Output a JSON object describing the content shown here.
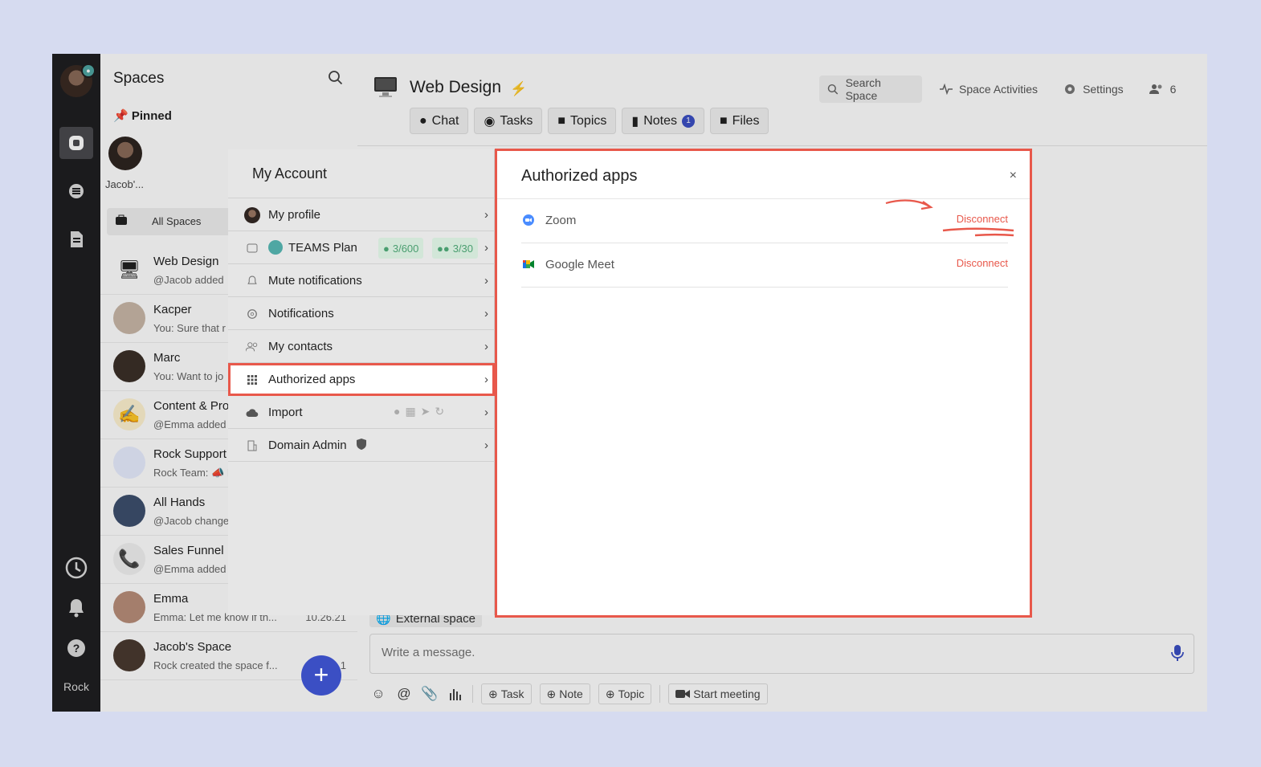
{
  "rail": {
    "label": "Rock"
  },
  "spaces": {
    "title": "Spaces",
    "pinned_label": "Pinned",
    "pinned_name": "Jacob'...",
    "all_spaces_label": "All Spaces",
    "items": [
      {
        "name": "Web Design",
        "sub": "@Jacob added",
        "time": "",
        "thumb": "🖥"
      },
      {
        "name": "Kacper",
        "sub": "You: Sure that r",
        "time": "",
        "thumb": ""
      },
      {
        "name": "Marc",
        "sub": "You: Want to jo",
        "time": "",
        "thumb": ""
      },
      {
        "name": "Content & Pro",
        "sub": "@Emma added",
        "time": "",
        "thumb": "✍"
      },
      {
        "name": "Rock Support",
        "sub": "Rock Team: 📣 I",
        "time": "",
        "thumb": ""
      },
      {
        "name": "All Hands",
        "sub": "@Jacob change",
        "time": "",
        "thumb": ""
      },
      {
        "name": "Sales Funnel",
        "sub": "@Emma added",
        "time": "",
        "thumb": "📞"
      },
      {
        "name": "Emma",
        "sub": "Emma: Let me know if th...",
        "time": "10.26.21",
        "thumb": ""
      },
      {
        "name": "Jacob's Space",
        "sub": "Rock created the space f...",
        "time": "1",
        "thumb": ""
      }
    ],
    "fab_label": "+"
  },
  "main": {
    "title": "Web Design",
    "tabs": [
      {
        "label": "Chat",
        "icon": "chat-bubble-icon"
      },
      {
        "label": "Tasks",
        "icon": "tasks-icon"
      },
      {
        "label": "Topics",
        "icon": "topics-icon"
      },
      {
        "label": "Notes",
        "icon": "notes-icon",
        "badge": "1"
      },
      {
        "label": "Files",
        "icon": "folder-icon"
      }
    ],
    "search_placeholder": "Search Space",
    "activities_label": "Space Activities",
    "settings_label": "Settings",
    "members_count": "6",
    "external_label": "External space",
    "composer_placeholder": "Write a message.",
    "toolbar": {
      "task": "Task",
      "note": "Note",
      "topic": "Topic",
      "meeting": "Start meeting"
    }
  },
  "account": {
    "title": "My Account",
    "items": [
      {
        "label": "My profile"
      },
      {
        "label": "TEAMS Plan",
        "pill1": "3/600",
        "pill2": "3/30"
      },
      {
        "label": "Mute notifications"
      },
      {
        "label": "Notifications"
      },
      {
        "label": "My contacts"
      },
      {
        "label": "Authorized apps"
      },
      {
        "label": "Import"
      },
      {
        "label": "Domain Admin"
      }
    ]
  },
  "dialog": {
    "title": "Authorized apps",
    "close": "×",
    "apps": [
      {
        "name": "Zoom",
        "action": "Disconnect"
      },
      {
        "name": "Google Meet",
        "action": "Disconnect"
      }
    ]
  },
  "colors": {
    "accent": "#3b4fc4",
    "highlight": "#e8584b",
    "rail_bg": "#1f1f21"
  }
}
